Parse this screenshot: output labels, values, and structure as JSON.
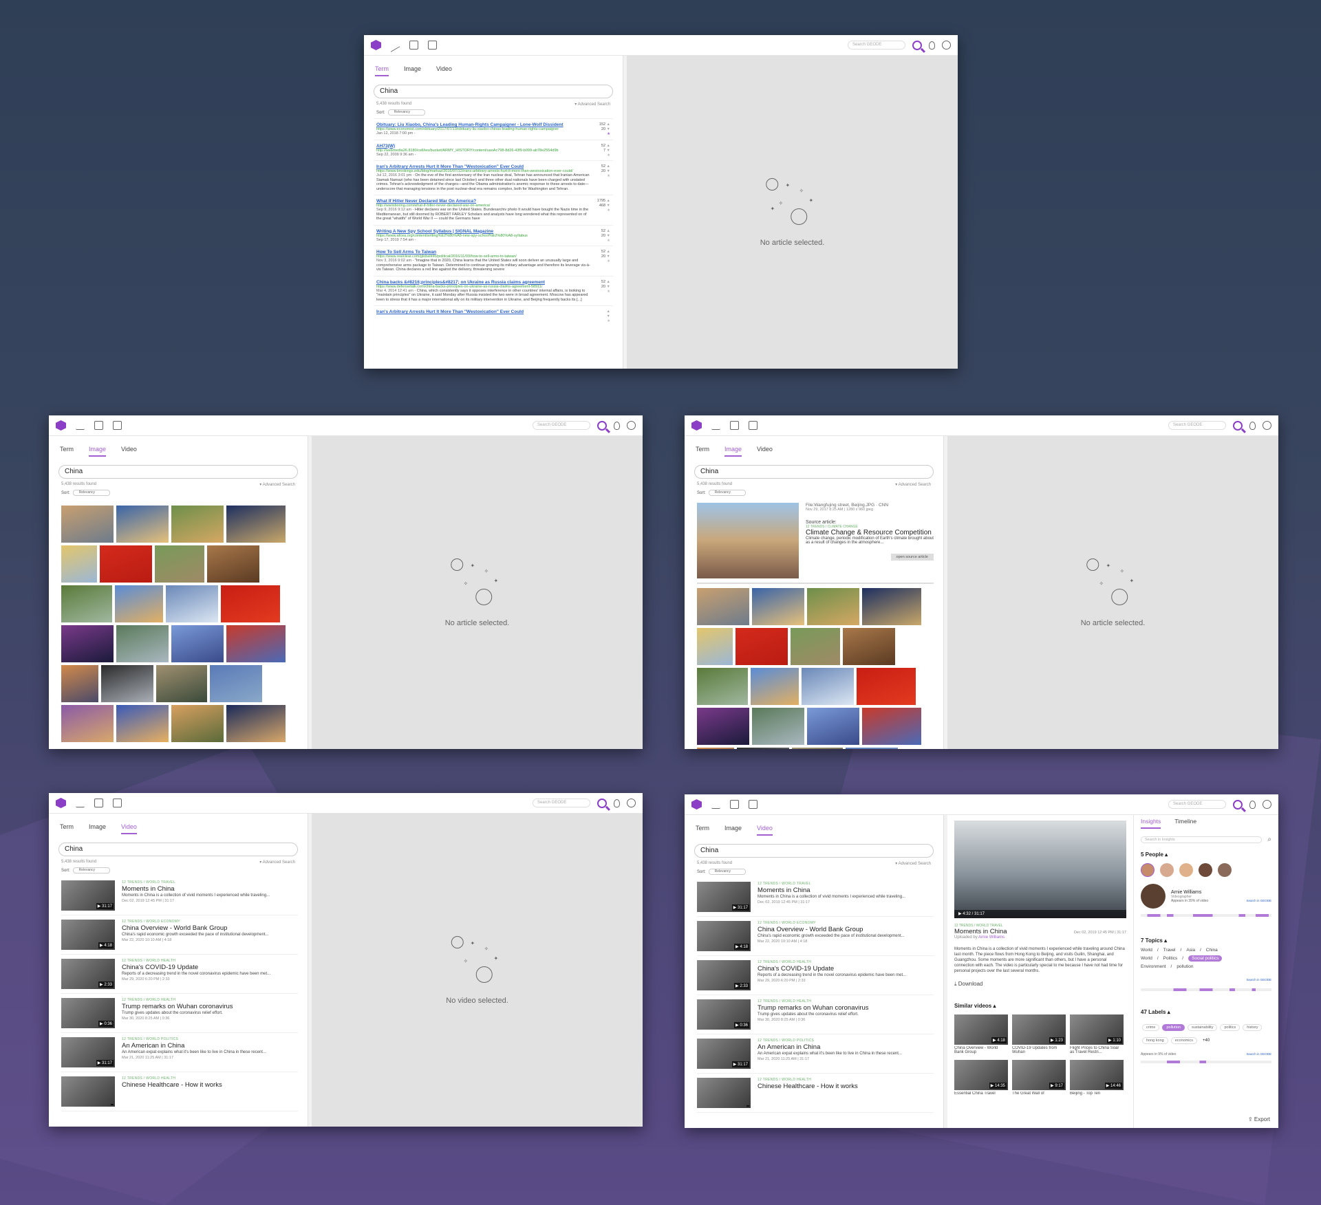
{
  "app": {
    "search_placeholder": "Search GEODE"
  },
  "tabs": {
    "term": "Term",
    "image": "Image",
    "video": "Video"
  },
  "query": "China",
  "results_found": "5,438 results found",
  "advanced_search": "▾ Advanced Search",
  "sort_label": "Sort:",
  "sort_value": "Relevancy",
  "no_article": "No article selected.",
  "no_video": "No video selected.",
  "articles": [
    {
      "title": "Obituary: Liu Xiaobo, China's Leading Human-Rights Campaigner - Lone-Wolf Dissident",
      "url": "https://www.economist.com/obituary/2017/07/13/obituary-liu-xiaobo-chinas-leading-human-rights-campaigner",
      "date": "Jan 12, 2018 7:00 pm -",
      "excerpt": "",
      "up": "152",
      "down": "20"
    },
    {
      "title": "AH73(W)",
      "url": "http://webmedia26.8180/cell/ies/bucket/ARMY_HISTORY/content/uaoAc798-8d26-43f9-b099-ab78e2554d9b",
      "date": "Sep 22, 2009 9:36 am -",
      "excerpt": "",
      "up": "52",
      "down": "7"
    },
    {
      "title": "Iran's Arbitrary Arrests Hurt It More Than \"Westoxication\" Ever Could",
      "url": "https://www.brookings.edu/blog/markaz/2016/07/12/irans-arbitrary-arrests-hurt-it-more-than-westoxication-ever-could/",
      "date": "Jul 12, 2016 3:01 pm -",
      "excerpt": "On the eve of the first anniversary of the Iran nuclear deal, Tehran has announced that Iranian-American Siamak Namazi (who has been detained since last October) and three other dual nationals have been charged with unstated crimes. Tehran's acknowledgment of the charges—and the Obama administration's anemic response to these arrests to date—underscore that managing tensions in the post nuclear-deal era remains complex, both for Washington and Tehran.",
      "up": "52",
      "down": "20"
    },
    {
      "title": "What If Hitler Never Declared War On America?",
      "url": "http://warisboring.com/what-if-hitler-never-declared-war-on-america/",
      "date": "Sep 9, 2016 9:12 am -",
      "excerpt": "Hitler declares war on the United States. Bundesarchiv photo It would have bought the Nazis time in the Mediterranean, but still doomed by ROBERT FARLEY Scholars and analysts have long wondered what this represented on of the great \"whatifs\" of World War II — could the Germans have",
      "up": "1795",
      "down": "468"
    },
    {
      "title": "Writing A New Spy School Syllabus | SIGNAL Magazine",
      "url": "https://www.afcea.org/content/writing%E2%80%A8-new-spy-school%E2%80%A8-syllabus",
      "date": "Sep 17, 2019 7:54 am -",
      "excerpt": "",
      "up": "52",
      "down": "20"
    },
    {
      "title": "How To Sell Arms To Taiwan",
      "url": "https://www.realclear.com/globalinfo/political/2016/11/03/how-to-sell-arms-to-taiwan/",
      "date": "Nov 3, 2016 9:02 am -",
      "excerpt": "\"Imagine that in 2020, China learns that the United States will soon deliver an unusually large and comprehensive arms package to Taiwan. Determined to continue growing its military advantage and therefore its leverage vis-à-vis Taiwan. China declares a red line against the delivery, threatening severe",
      "up": "52",
      "down": "20"
    },
    {
      "title": "China backs &#8216;principles&#8217; on Ukraine as Russia claims agreement",
      "url": "https://www.defensetalk.com/china-backs-principles-on-ukraine-as-russia-claims-agreement-58911/",
      "date": "Mar 4, 2014 12:41 am -",
      "excerpt": "China, which consistently says it opposes interference in other countries' internal affairs, is looking to \"maintain principles\" on Ukraine, it said Monday after Russia insisted the two were in broad agreement. Moscow has appeared keen to stress that it has a major international ally on its military intervention in Ukraine, and Beijing frequently backs its [...]",
      "up": "52",
      "down": "20"
    },
    {
      "title": "Iran's Arbitrary Arrests Hurt It More Than \"Westoxication\" Ever Could",
      "url": "",
      "date": "",
      "excerpt": "",
      "up": "",
      "down": ""
    }
  ],
  "image_detail": {
    "file": "File:Wangfujing street, Beijing.JPG · CNN",
    "date": "Nov 29, 2017 8:25 AM | 1280 x 960 jpeg",
    "source_label": "Source article:",
    "trend": "12 TRENDS / CLIMATE CHANGE",
    "title": "Climate Change & Resource Competition",
    "excerpt": "Climate change, periodic modification of Earth's climate brought about as a result of changes in the atmosphere...",
    "open": "open source article"
  },
  "videos": [
    {
      "trend": "12 TRENDS / WORLD TRAVEL",
      "title": "Moments in China",
      "desc": "Moments in China is a collection of vivid moments I experienced while traveling...",
      "date": "Dec 02, 2019 12:45 PM | 31:17",
      "dur": "▶ 31:17"
    },
    {
      "trend": "12 TRENDS / WORLD ECONOMY",
      "title": "China Overview - World Bank Group",
      "desc": "China's rapid economic growth exceeded the pace of institutional development...",
      "date": "Mar 22, 2020 10:10 AM | 4:18",
      "dur": "▶ 4:18"
    },
    {
      "trend": "12 TRENDS / WORLD HEALTH",
      "title": "China's COVID-19 Update",
      "desc": "Reports of a decreasing trend in the novel coronavirus epidemic have been met...",
      "date": "Mar 29, 2020 6:20 PM | 2:33",
      "dur": "▶ 2:33"
    },
    {
      "trend": "12 TRENDS / WORLD HEALTH",
      "title": "Trump remarks on Wuhan coronavirus",
      "desc": "Trump gives updates about the coronavirus relief effort.",
      "date": "Mar 30, 2020 8:25 AM | 0:36",
      "dur": "▶ 0:36"
    },
    {
      "trend": "12 TRENDS / WORLD POLITICS",
      "title": "An American in China",
      "desc": "An American expat explains what it's been like to live in China in these recent...",
      "date": "Mar 21, 2020 11:25 AM | 31:17",
      "dur": "▶ 31:17"
    },
    {
      "trend": "12 TRENDS / WORLD HEALTH",
      "title": "Chinese Healthcare - How it works",
      "desc": "",
      "date": "",
      "dur": ""
    }
  ],
  "video_detail": {
    "player_time": "4:32 / 31:17",
    "title": "Moments in China",
    "date": "Dec 02, 2019 12:45 PM | 31:17",
    "uploaded_prefix": "Uploaded by",
    "uploader": "Arnie Williams",
    "desc": "Moments in China is a collection of vivid moments I experienced while traveling around China last month. The piece flows from Hong Kong to Beijing, and visits Guilin, Shanghai, and Guangzhou. Some moments are more significant than others, but I have a personal connection with each. The video is particularly special to me because I have not had time for personal projects over the last several months.",
    "download": "Download",
    "similar": "Similar videos ▴",
    "similar_items": [
      {
        "t": "China Overview - World Bank Group",
        "d": "▶ 4:18"
      },
      {
        "t": "COVID-19 Updates from Wuhan",
        "d": "▶ 1:23"
      },
      {
        "t": "Flight Prices to China Soar as Travel Restri...",
        "d": "▶ 1:10"
      },
      {
        "t": "Essential China Travel",
        "d": "▶ 14:35"
      },
      {
        "t": "The Great Wall of",
        "d": "▶ 9:17"
      },
      {
        "t": "Beijing - Top Ten",
        "d": "▶ 14:46"
      }
    ]
  },
  "insights": {
    "tab_insights": "Insights",
    "tab_timeline": "Timeline",
    "search": "Search in Insights",
    "people": "5 People ▴",
    "person_name": "Arnie Williams",
    "person_role": "Videographer",
    "person_pct": "Appears in 35% of video",
    "search_geode": "Search in GEODE",
    "topics": "7 Topics ▴",
    "topic_rows": [
      [
        "World",
        "/",
        "Travel",
        "/",
        "Asia",
        "/",
        "China"
      ],
      [
        "World",
        "/",
        "Politics",
        "/",
        "Social politics"
      ],
      [
        "Environment",
        "/",
        "pollution"
      ]
    ],
    "labels": "47 Labels ▴",
    "label_items": [
      "crime",
      "pollution",
      "sustainability",
      "politics",
      "history",
      "hong kong",
      "economics"
    ],
    "more": "+40",
    "labels_pct": "Appears in 9% of video",
    "export": "Export"
  }
}
